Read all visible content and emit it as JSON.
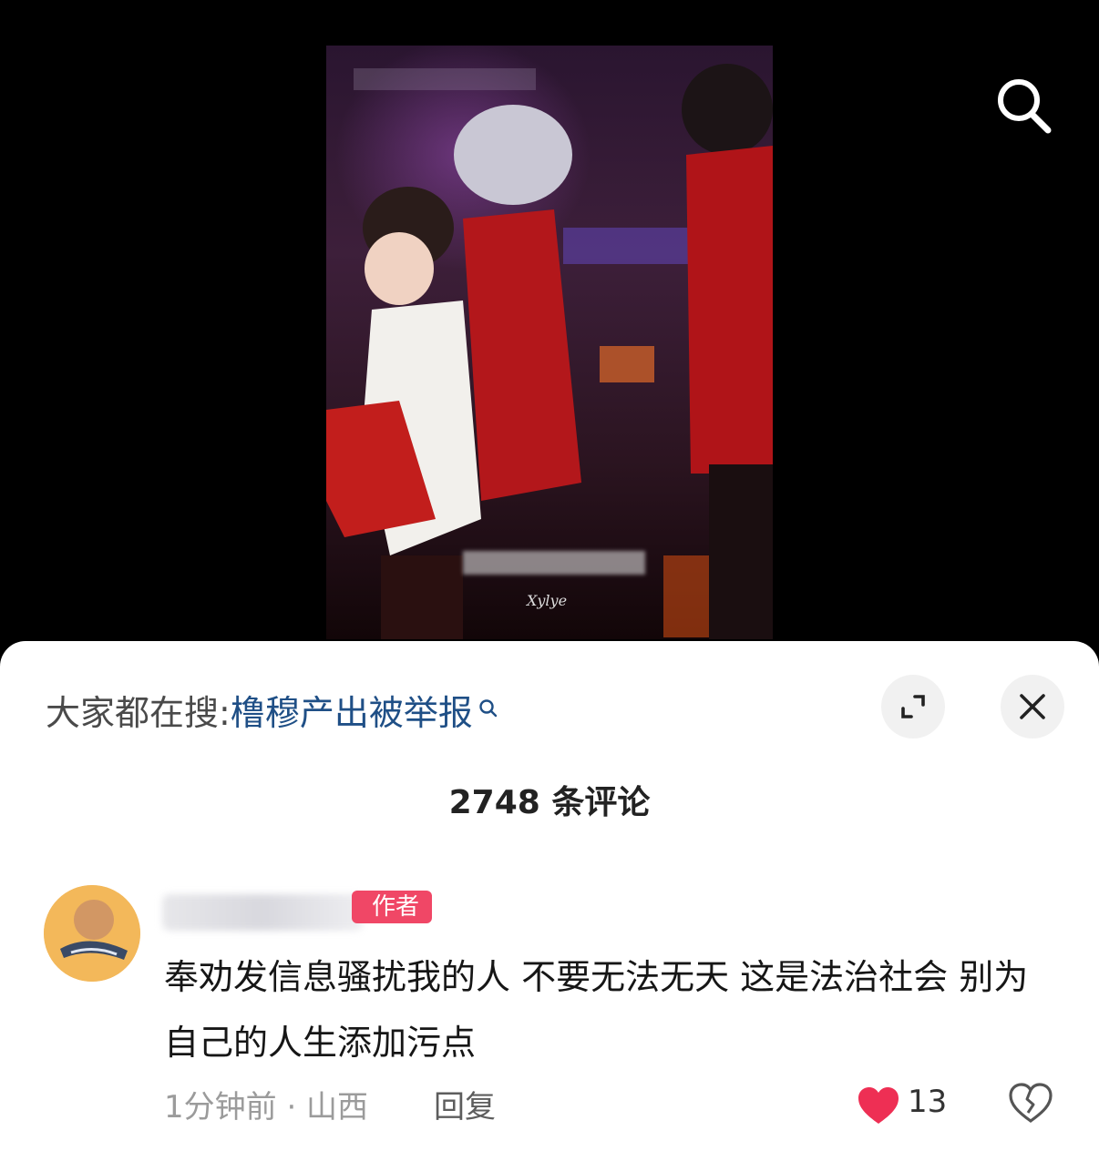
{
  "search": {
    "icon": "search-icon"
  },
  "video": {
    "watermark": "Xylye"
  },
  "trending": {
    "prefix": "大家都在搜:",
    "topic": "橹穆产出被举报",
    "topic_color": "#1f4f86"
  },
  "comments_header": {
    "count_label": "2748 条评论"
  },
  "comment": {
    "author_badge": "作者",
    "text": "奉劝发信息骚扰我的人 不要无法无天 这是法治社会 别为自己的人生添加污点",
    "meta": "1分钟前 · 山西",
    "reply_label": "回复",
    "like_count": "13"
  },
  "colors": {
    "badge": "#f04766",
    "heart": "#ee2f54",
    "link": "#1f4f86"
  }
}
